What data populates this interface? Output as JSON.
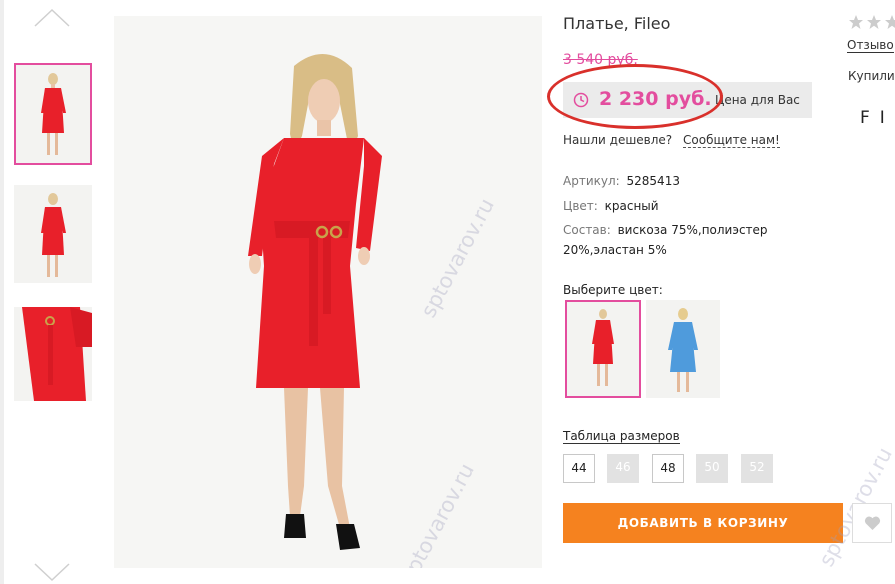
{
  "product": {
    "title": "Платье, Fileo",
    "old_price": "3 540 руб.",
    "price": "2 230 руб.",
    "your_price_label": "Цена для Вас",
    "cheaper_question": "Нашли дешевле?",
    "cheaper_link": "Сообщите нам!",
    "article_label": "Артикул:",
    "article_value": "5285413",
    "color_label": "Цвет:",
    "color_value": "красный",
    "composition_label": "Состав:",
    "composition_line1": "вискоза 75%,полиэстер",
    "composition_line2": "20%,эластан 5%",
    "choose_color_label": "Выберите цвет:",
    "size_table_link": "Таблица размеров",
    "sizes": [
      {
        "label": "44",
        "available": true
      },
      {
        "label": "46",
        "available": false
      },
      {
        "label": "48",
        "available": true
      },
      {
        "label": "50",
        "available": false
      },
      {
        "label": "52",
        "available": false
      }
    ],
    "add_to_cart_label": "ДОБАВИТЬ В КОРЗИНУ"
  },
  "side": {
    "reviews_link": "Отзыво",
    "bought_text": "Купили",
    "brand_partial": "FI"
  },
  "watermarks": [
    "sptovarov.ru",
    "sptovarov.ru",
    "sptovarov.ru"
  ],
  "colors": {
    "accent_pink": "#e34d9e",
    "cart_orange": "#f5821f",
    "dress_red": "#e8202a",
    "swatch_blue": "#4f9bdc",
    "highlight_red": "#d9302b"
  },
  "icons": [
    "chevron-up-icon",
    "chevron-down-icon",
    "clock-icon",
    "heart-icon",
    "star-icon"
  ]
}
